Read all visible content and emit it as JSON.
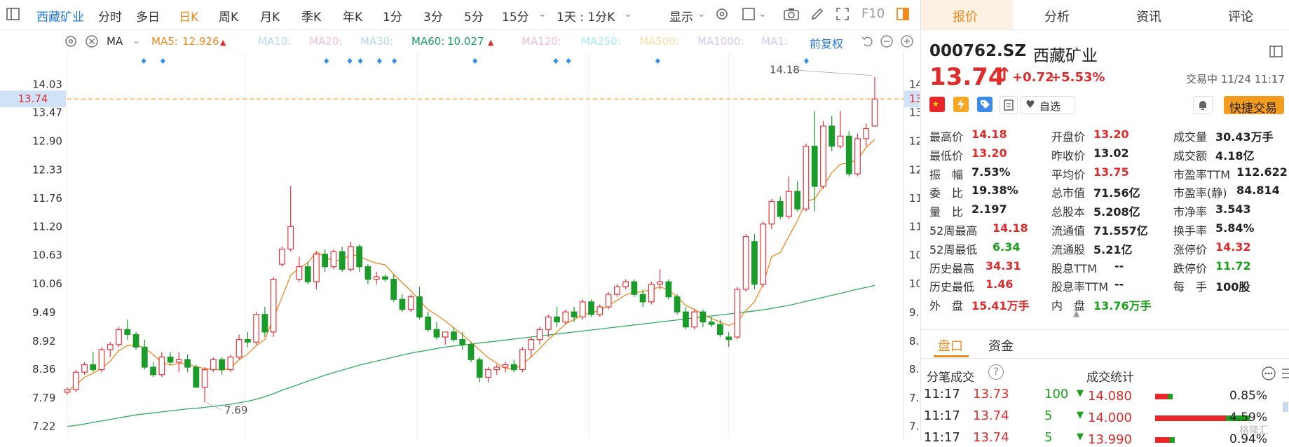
{
  "toolbar": {
    "stock_name": "西藏矿业",
    "periods": [
      "分时",
      "多日",
      "日K",
      "周K",
      "月K",
      "季K",
      "年K",
      "1分",
      "3分",
      "5分",
      "15分"
    ],
    "selected_period": "日K",
    "interval_label": "1天 : 1分K",
    "display_label": "显示",
    "f10_label": "F10"
  },
  "ma_bar": {
    "ma_select": "MA",
    "ma5_label": "MA5:",
    "ma5_value": "12.926",
    "ma10": "MA10:",
    "ma20": "MA20:",
    "ma30": "MA30:",
    "ma60_label": "MA60:",
    "ma60_value": "10.027",
    "ma120": "MA120:",
    "ma250": "MA250:",
    "ma500": "MA500:",
    "ma1000": "MA1000:",
    "ma1": "MA1:",
    "adjust_label": "前复权"
  },
  "chart_data": {
    "type": "candlestick",
    "y_ticks": [
      14.03,
      13.47,
      12.9,
      12.33,
      11.76,
      11.2,
      10.63,
      10.06,
      9.49,
      8.92,
      8.36,
      7.79,
      7.22
    ],
    "ylim": [
      6.95,
      14.65
    ],
    "current_price_label": "13.74",
    "current_price": 13.74,
    "high_annotation": "14.18",
    "low_annotation": "7.69",
    "grid": true,
    "ohlc": [
      [
        7.9,
        8.0,
        7.85,
        7.95
      ],
      [
        7.95,
        8.35,
        7.9,
        8.3
      ],
      [
        8.3,
        8.5,
        8.25,
        8.45
      ],
      [
        8.45,
        8.7,
        8.3,
        8.35
      ],
      [
        8.35,
        8.8,
        8.3,
        8.75
      ],
      [
        8.75,
        8.9,
        8.6,
        8.85
      ],
      [
        8.85,
        9.2,
        8.8,
        9.15
      ],
      [
        9.15,
        9.35,
        8.95,
        9.05
      ],
      [
        9.05,
        9.1,
        8.75,
        8.8
      ],
      [
        8.8,
        8.95,
        8.35,
        8.4
      ],
      [
        8.4,
        8.5,
        8.2,
        8.25
      ],
      [
        8.25,
        8.7,
        8.2,
        8.6
      ],
      [
        8.6,
        8.7,
        8.45,
        8.5
      ],
      [
        8.5,
        8.7,
        8.3,
        8.55
      ],
      [
        8.55,
        8.65,
        8.3,
        8.4
      ],
      [
        8.4,
        8.45,
        8.0,
        8.0
      ],
      [
        8.0,
        8.4,
        7.7,
        8.35
      ],
      [
        8.35,
        8.6,
        8.3,
        8.55
      ],
      [
        8.55,
        8.6,
        8.25,
        8.35
      ],
      [
        8.35,
        8.65,
        8.3,
        8.6
      ],
      [
        8.6,
        9.05,
        8.55,
        8.95
      ],
      [
        8.95,
        9.1,
        8.8,
        8.9
      ],
      [
        8.9,
        9.5,
        8.85,
        9.45
      ],
      [
        9.45,
        9.6,
        9.0,
        9.1
      ],
      [
        9.1,
        10.2,
        9.0,
        10.15
      ],
      [
        10.45,
        10.8,
        10.4,
        10.75
      ],
      [
        10.75,
        12.0,
        10.7,
        11.2
      ],
      [
        10.15,
        10.6,
        10.1,
        10.4
      ],
      [
        10.4,
        10.5,
        10.05,
        10.1
      ],
      [
        10.1,
        10.7,
        9.95,
        10.65
      ],
      [
        10.65,
        10.75,
        10.3,
        10.4
      ],
      [
        10.4,
        10.75,
        10.35,
        10.7
      ],
      [
        10.7,
        10.8,
        10.3,
        10.35
      ],
      [
        10.35,
        10.9,
        10.3,
        10.8
      ],
      [
        10.8,
        10.85,
        10.3,
        10.4
      ],
      [
        10.4,
        10.45,
        10.05,
        10.15
      ],
      [
        10.15,
        10.3,
        10.05,
        10.2
      ],
      [
        10.2,
        10.25,
        10.1,
        10.15
      ],
      [
        10.15,
        10.25,
        9.7,
        9.75
      ],
      [
        9.75,
        9.85,
        9.5,
        9.55
      ],
      [
        9.55,
        9.85,
        9.5,
        9.8
      ],
      [
        9.8,
        10.0,
        9.35,
        9.4
      ],
      [
        9.4,
        9.5,
        9.1,
        9.15
      ],
      [
        9.15,
        9.3,
        8.95,
        9.0
      ],
      [
        9.0,
        9.1,
        8.85,
        9.1
      ],
      [
        9.1,
        9.2,
        8.9,
        8.95
      ],
      [
        8.95,
        9.1,
        8.75,
        8.85
      ],
      [
        8.85,
        8.9,
        8.5,
        8.55
      ],
      [
        8.55,
        8.6,
        8.1,
        8.2
      ],
      [
        8.2,
        8.4,
        8.1,
        8.35
      ],
      [
        8.35,
        8.45,
        8.25,
        8.4
      ],
      [
        8.4,
        8.5,
        8.3,
        8.45
      ],
      [
        8.45,
        8.55,
        8.3,
        8.35
      ],
      [
        8.35,
        8.8,
        8.3,
        8.75
      ],
      [
        8.75,
        9.0,
        8.6,
        8.95
      ],
      [
        8.95,
        9.2,
        8.85,
        9.15
      ],
      [
        9.15,
        9.45,
        9.0,
        9.4
      ],
      [
        9.4,
        9.6,
        9.2,
        9.3
      ],
      [
        9.3,
        9.55,
        9.25,
        9.5
      ],
      [
        9.5,
        9.6,
        9.3,
        9.4
      ],
      [
        9.4,
        9.75,
        9.35,
        9.7
      ],
      [
        9.7,
        9.75,
        9.4,
        9.45
      ],
      [
        9.45,
        9.65,
        9.4,
        9.6
      ],
      [
        9.6,
        9.9,
        9.55,
        9.85
      ],
      [
        9.85,
        10.05,
        9.8,
        10.0
      ],
      [
        10.0,
        10.15,
        9.95,
        10.1
      ],
      [
        10.1,
        10.15,
        9.8,
        9.85
      ],
      [
        9.85,
        9.95,
        9.6,
        9.7
      ],
      [
        9.7,
        10.1,
        9.65,
        10.05
      ],
      [
        10.05,
        10.35,
        9.95,
        10.1
      ],
      [
        10.1,
        10.15,
        9.75,
        9.8
      ],
      [
        9.8,
        9.85,
        9.45,
        9.5
      ],
      [
        9.5,
        9.6,
        9.15,
        9.2
      ],
      [
        9.2,
        9.55,
        9.15,
        9.5
      ],
      [
        9.5,
        9.55,
        9.2,
        9.3
      ],
      [
        9.3,
        9.4,
        9.2,
        9.25
      ],
      [
        9.25,
        9.35,
        9.0,
        9.05
      ],
      [
        9.0,
        9.1,
        8.8,
        8.95
      ],
      [
        9.0,
        10.0,
        8.95,
        9.95
      ],
      [
        9.95,
        11.05,
        9.9,
        11.0
      ],
      [
        10.9,
        11.05,
        9.95,
        10.05
      ],
      [
        10.05,
        11.3,
        10.0,
        11.25
      ],
      [
        11.25,
        11.75,
        11.15,
        11.7
      ],
      [
        11.7,
        11.8,
        11.35,
        11.4
      ],
      [
        11.4,
        12.2,
        11.35,
        11.9
      ],
      [
        11.9,
        12.1,
        11.5,
        11.55
      ],
      [
        11.55,
        12.85,
        11.5,
        12.8
      ],
      [
        12.8,
        13.5,
        11.5,
        12.0
      ],
      [
        12.0,
        13.3,
        11.95,
        13.2
      ],
      [
        13.2,
        13.4,
        12.7,
        12.8
      ],
      [
        12.8,
        13.5,
        12.75,
        13.0
      ],
      [
        13.0,
        13.1,
        12.2,
        12.25
      ],
      [
        12.25,
        13.05,
        12.2,
        12.95
      ],
      [
        12.95,
        13.25,
        12.8,
        13.15
      ],
      [
        13.2,
        14.18,
        13.2,
        13.74
      ]
    ],
    "ma5": [
      7.92,
      8.05,
      8.2,
      8.28,
      8.38,
      8.52,
      8.73,
      8.83,
      8.84,
      8.78,
      8.65,
      8.49,
      8.44,
      8.48,
      8.46,
      8.41,
      8.37,
      8.36,
      8.34,
      8.38,
      8.55,
      8.66,
      8.83,
      8.95,
      9.38,
      9.79,
      10.23,
      10.37,
      10.48,
      10.7,
      10.6,
      10.51,
      10.54,
      10.64,
      10.61,
      10.53,
      10.47,
      10.44,
      10.25,
      10.08,
      9.92,
      9.73,
      9.54,
      9.44,
      9.32,
      9.18,
      9.05,
      8.9,
      8.74,
      8.59,
      8.48,
      8.38,
      8.36,
      8.46,
      8.6,
      8.77,
      8.95,
      9.1,
      9.26,
      9.35,
      9.45,
      9.48,
      9.53,
      9.63,
      9.73,
      9.84,
      9.89,
      9.9,
      9.95,
      10.0,
      9.94,
      9.8,
      9.63,
      9.55,
      9.45,
      9.37,
      9.3,
      9.23,
      9.3,
      9.53,
      9.7,
      10.05,
      10.6,
      10.68,
      11.0,
      11.32,
      11.7,
      11.75,
      12.0,
      12.27,
      12.44,
      12.47,
      12.53,
      12.78,
      12.93
    ],
    "ma60": [
      7.22,
      7.24,
      7.27,
      7.3,
      7.33,
      7.36,
      7.39,
      7.42,
      7.45,
      7.47,
      7.49,
      7.51,
      7.53,
      7.55,
      7.57,
      7.58,
      7.6,
      7.62,
      7.64,
      7.66,
      7.69,
      7.72,
      7.76,
      7.81,
      7.87,
      7.94,
      8.0,
      8.06,
      8.12,
      8.18,
      8.24,
      8.29,
      8.34,
      8.39,
      8.44,
      8.48,
      8.52,
      8.56,
      8.6,
      8.64,
      8.68,
      8.71,
      8.74,
      8.77,
      8.8,
      8.82,
      8.84,
      8.86,
      8.88,
      8.9,
      8.92,
      8.94,
      8.96,
      8.98,
      9.0,
      9.02,
      9.04,
      9.06,
      9.08,
      9.1,
      9.12,
      9.14,
      9.16,
      9.18,
      9.2,
      9.22,
      9.24,
      9.26,
      9.28,
      9.3,
      9.32,
      9.34,
      9.36,
      9.38,
      9.4,
      9.42,
      9.44,
      9.46,
      9.48,
      9.5,
      9.52,
      9.54,
      9.57,
      9.6,
      9.63,
      9.67,
      9.71,
      9.75,
      9.79,
      9.83,
      9.87,
      9.91,
      9.95,
      9.99,
      10.03
    ]
  },
  "quote": {
    "code": "000762.SZ",
    "name": "西藏矿业",
    "price": "13.74",
    "change": "+0.72",
    "change_pct": "+5.53%",
    "status": "交易中 11/24 11:17",
    "watch_label": "自选",
    "quick_trade": "快捷交易",
    "tabs": [
      "报价",
      "分析",
      "资讯",
      "评论"
    ],
    "fields": [
      {
        "l": "最高价",
        "v": "14.18",
        "c": "red"
      },
      {
        "l": "开盘价",
        "v": "13.20",
        "c": "red"
      },
      {
        "l": "成交量",
        "v": "30.43万手",
        "c": "dark"
      },
      {
        "l": "最低价",
        "v": "13.20",
        "c": "red"
      },
      {
        "l": "昨收价",
        "v": "13.02",
        "c": "dark"
      },
      {
        "l": "成交额",
        "v": "4.18亿",
        "c": "dark"
      },
      {
        "l": "振　幅",
        "v": "7.53%",
        "c": "dark"
      },
      {
        "l": "平均价",
        "v": "13.75",
        "c": "red"
      },
      {
        "l": "市盈率TTM",
        "v": "112.622",
        "c": "dark"
      },
      {
        "l": "委　比",
        "v": "19.38%",
        "c": "dark"
      },
      {
        "l": "总市值",
        "v": "71.56亿",
        "c": "dark"
      },
      {
        "l": "市盈率(静)",
        "v": "84.814",
        "c": "dark"
      },
      {
        "l": "量　比",
        "v": "2.197",
        "c": "dark"
      },
      {
        "l": "总股本",
        "v": "5.208亿",
        "c": "dark"
      },
      {
        "l": "市净率",
        "v": "3.543",
        "c": "dark"
      },
      {
        "l": "52周最高",
        "v": "14.18",
        "c": "red"
      },
      {
        "l": "流通值",
        "v": "71.557亿",
        "c": "dark"
      },
      {
        "l": "换手率",
        "v": "5.84%",
        "c": "dark"
      },
      {
        "l": "52周最低",
        "v": "6.34",
        "c": "green"
      },
      {
        "l": "流通股",
        "v": "5.21亿",
        "c": "dark"
      },
      {
        "l": "涨停价",
        "v": "14.32",
        "c": "red"
      },
      {
        "l": "历史最高",
        "v": "34.31",
        "c": "red"
      },
      {
        "l": "股息TTM",
        "v": "--",
        "c": "dark"
      },
      {
        "l": "跌停价",
        "v": "11.72",
        "c": "green"
      },
      {
        "l": "历史最低",
        "v": "1.46",
        "c": "red"
      },
      {
        "l": "股息率TTM",
        "v": "--",
        "c": "dark"
      },
      {
        "l": "每　手",
        "v": "100股",
        "c": "dark"
      },
      {
        "l": "外　盘",
        "v": "15.41万手",
        "c": "red"
      },
      {
        "l": "内　盘",
        "v": "13.76万手",
        "c": "green"
      }
    ],
    "sub_tabs": [
      "盘口",
      "资金"
    ],
    "ticks_title": "分笔成交",
    "ticks_help": "?",
    "stats_title": "成交统计",
    "ticks": [
      {
        "time": "11:17",
        "price": "13.73",
        "vol": "100"
      },
      {
        "time": "11:17",
        "price": "13.74",
        "vol": "5"
      },
      {
        "time": "11:17",
        "price": "13.74",
        "vol": "5"
      }
    ],
    "stats": [
      {
        "price": "14.080",
        "pct": "0.85%",
        "share": 0.0085
      },
      {
        "price": "14.000",
        "pct": "4.59%",
        "share": 0.0459
      },
      {
        "price": "13.990",
        "pct": "0.94%",
        "share": 0.0094
      }
    ],
    "watermark": "格隆汇"
  }
}
